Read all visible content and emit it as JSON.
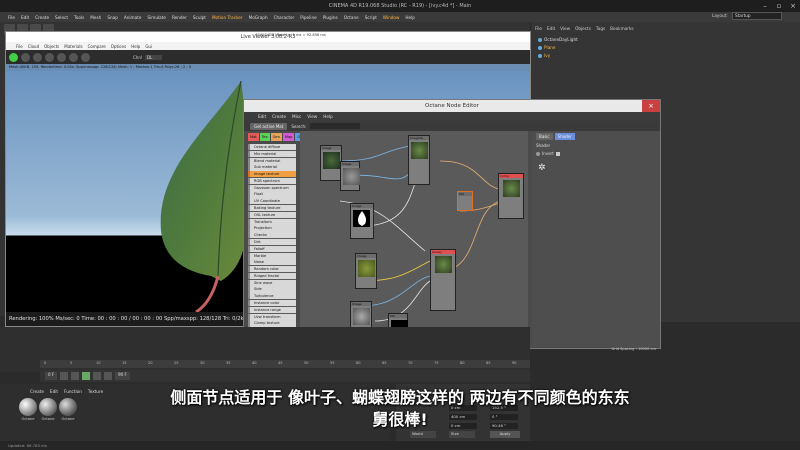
{
  "app": {
    "title": "CINEMA 4D R19.068 Studio (RC - R19) - [ivy.c4d *] - Main",
    "layout_label": "Layout:",
    "layout_value": "Startup"
  },
  "menubar": [
    "File",
    "Edit",
    "Create",
    "Select",
    "Tools",
    "Mesh",
    "Snap",
    "Animate",
    "Simulate",
    "Render",
    "Sculpt",
    "Motion Tracker",
    "MoGraph",
    "Character",
    "Pipeline",
    "Plugins",
    "Octane",
    "Script",
    "Window",
    "Help"
  ],
  "live_viewer": {
    "title": "Live Viewer 3.08.2-R3",
    "title_info": "[FINISHED] Total tri: 1 ms = 92.856 ms",
    "menu": [
      "File",
      "Cloud",
      "Objects",
      "Materials",
      "Compare",
      "Options",
      "Help",
      "Gui"
    ],
    "channel_label": "Chnl",
    "channel_value": "DL",
    "info": "Mesh:40KB, 150; Rendertime: 0.04s; Spp/maxspp: 128/128; Mesh: 1 ; Meshes:1 Tris:4 Polys:26 ; 2 ; 0",
    "status": "Rendering: 100%  Ms/sec: 0   Time: 00 : 00 : 00 / 00 : 00 : 00   Spp/maxspp: 128/128   Tri: 0/2k   Mesh: 1   Hair: 0   GPU: 38"
  },
  "objects_panel": {
    "tabs": [
      "File",
      "Edit",
      "View",
      "Objects",
      "Tags",
      "Bookmarks"
    ],
    "items": [
      "OctaneDayLight",
      "Plane",
      "Ivy"
    ]
  },
  "node_editor": {
    "title": "Octane Node Editor",
    "menu": [
      "Edit",
      "Create",
      "Misc",
      "View",
      "Help"
    ],
    "get_button": "Get active Mat",
    "search_label": "Search:",
    "categories": [
      "Mat",
      "Tex",
      "Gen",
      "Map",
      "Oth",
      "Emi",
      "Med",
      "C4D",
      "All"
    ],
    "category_colors": [
      "#e35b5b",
      "#5bd35b",
      "#e3a35b",
      "#d35bd3",
      "#5b9be3",
      "#e3e35b",
      "#5be3e3",
      "#a35be3",
      "#cccccc"
    ],
    "node_list": [
      "Octane diffuse",
      "Mix material",
      "Blend material",
      "Sub material",
      "Image texture",
      "RGB spectrum",
      "Gaussian spectrum",
      "Float",
      "UV Coordinate",
      "Baking texture",
      "OSL texture",
      "Transform",
      "Projection",
      "Checks",
      "Dirt",
      "Falloff",
      "Marble",
      "Noise",
      "Random color",
      "Ridged fractal",
      "Sine wave",
      "Side",
      "Turbulence",
      "Instance color",
      "Instance range",
      "Uvw transform",
      "Clamp texture"
    ],
    "selected_index": 4,
    "side_tabs": [
      "Basic",
      "Shader"
    ],
    "side_header": "Shader",
    "side_field": "Invert",
    "grid_spacing": "Grid Spacing : 10000 cm",
    "nodes": [
      "Image",
      "Image",
      "Image",
      "ImageTe..",
      "Image",
      "Image",
      "Mix",
      "Glossy",
      "Mix",
      "Comp"
    ]
  },
  "timeline": {
    "ticks": [
      "0",
      "5",
      "10",
      "15",
      "20",
      "25",
      "30",
      "35",
      "40",
      "45",
      "50",
      "55",
      "60",
      "65",
      "70",
      "75",
      "80",
      "85",
      "90"
    ],
    "frame_start": "0 F",
    "frame_end": "90 F"
  },
  "materials": {
    "menu": [
      "Create",
      "Edit",
      "Function",
      "Texture"
    ],
    "items": [
      "Octane",
      "Octane",
      "Octane"
    ]
  },
  "attributes": {
    "rows": [
      "0 cm",
      "400 cm",
      "0 cm"
    ],
    "rows_b": [
      "152.5 °",
      "0 °",
      "90.46 °"
    ],
    "world": "World",
    "size": "Size",
    "apply": "Apply"
  },
  "status_bar": "Updated: 66.783 ms",
  "subtitle": {
    "line1": "侧面节点适用于 像叶子、蝴蝶翅膀这样的 两边有不同颜色的东东",
    "line2": "舅很棒!"
  }
}
